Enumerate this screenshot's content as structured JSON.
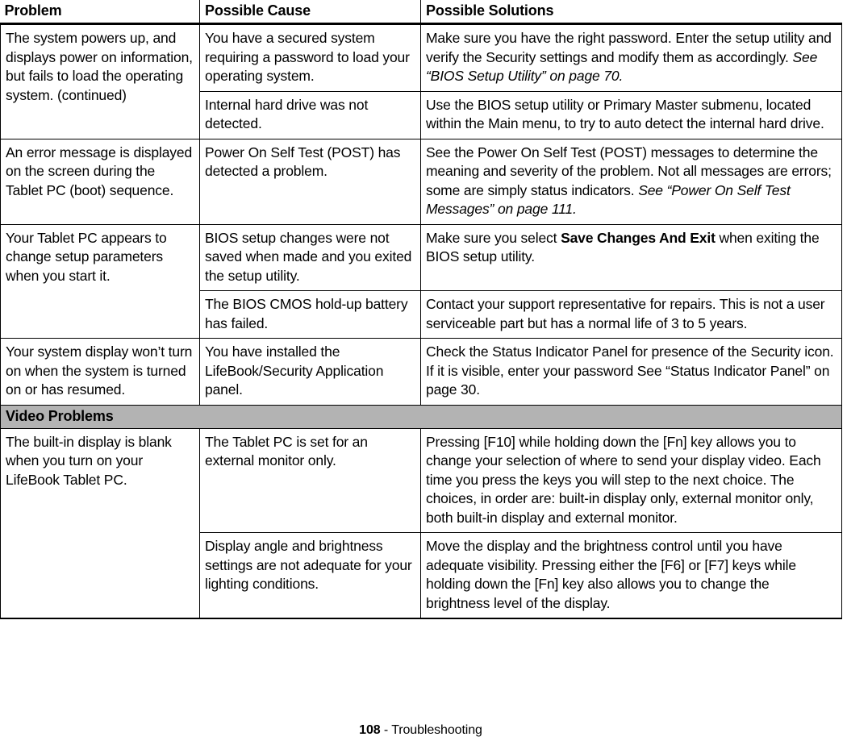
{
  "table": {
    "headers": {
      "problem": "Problem",
      "cause": "Possible Cause",
      "solution": "Possible Solutions"
    },
    "rows": [
      {
        "problem": "The system powers up, and displays power on information, but fails to load the operating system. (continued)",
        "entries": [
          {
            "cause": "You have a secured system requiring a password to load your operating system.",
            "solution_plain_1": "Make sure you have the right password. Enter the setup utility and verify the Security settings and modify them as accordingly. ",
            "solution_italic": "See “BIOS Setup Utility” on page 70.",
            "solution_plain_2": ""
          },
          {
            "cause": "Internal hard drive was not detected.",
            "solution_plain_1": "Use the BIOS setup utility or Primary Master submenu, located within the Main menu, to try to auto detect the internal hard drive.",
            "solution_italic": "",
            "solution_plain_2": ""
          }
        ]
      },
      {
        "problem": "An error message is displayed on the screen during the Tablet PC (boot) sequence.",
        "entries": [
          {
            "cause": "Power On Self Test (POST) has detected a problem.",
            "solution_plain_1": "See the Power On Self Test (POST) messages to determine the meaning and severity of the problem. Not all messages are errors; some are simply status indicators. ",
            "solution_italic": "See “Power On Self Test Messages” on page 111.",
            "solution_plain_2": ""
          }
        ]
      },
      {
        "problem": "Your Tablet PC appears to change setup parameters when you start it.",
        "entries": [
          {
            "cause": "BIOS setup changes were not saved when made and you exited the setup utility.",
            "solution_plain_1": "Make sure you select ",
            "solution_bold": "Save Changes And Exit",
            "solution_plain_2": " when exiting the BIOS setup utility."
          },
          {
            "cause": "The BIOS CMOS hold-up battery has failed.",
            "solution_plain_1": "Contact your support representative for repairs. This is not a user serviceable part but has a normal life of 3 to 5 years.",
            "solution_italic": "",
            "solution_plain_2": ""
          }
        ]
      },
      {
        "problem": "Your system display won’t turn on when the system is turned on or has resumed.",
        "entries": [
          {
            "cause": "You have installed the LifeBook/Security Application panel.",
            "solution_plain_1": "Check the Status Indicator Panel for presence of the Security icon. If it is visible, enter your password See “Status Indicator Panel” on page 30.",
            "solution_italic": "",
            "solution_plain_2": ""
          }
        ]
      }
    ],
    "section_band": "Video Problems",
    "rows_after_band": [
      {
        "problem": "The built-in display is blank when you turn on your LifeBook Tablet PC.",
        "entries": [
          {
            "cause": "The Tablet PC is set for an external monitor only.",
            "solution_plain_1": "Pressing [F10] while holding down the [Fn] key allows you to change your selection of where to send your display video. Each time you press the keys you will step to the next choice. The choices, in order are: built-in display only, external monitor only, both built-in display and external monitor.",
            "solution_italic": "",
            "solution_plain_2": ""
          },
          {
            "cause": "Display angle and brightness settings are not adequate for your lighting conditions.",
            "solution_plain_1": "Move the display and the brightness control until you have adequate visibility. Pressing either the [F6] or [F7] keys while holding down the [Fn] key also allows you to change the brightness level of the display.",
            "solution_italic": "",
            "solution_plain_2": ""
          }
        ]
      }
    ]
  },
  "footer": {
    "page_number": "108",
    "separator_and_section": " - Troubleshooting"
  },
  "colors": {
    "section_band_background": "#b3b3b3",
    "text": "#000000",
    "border": "#000000"
  }
}
